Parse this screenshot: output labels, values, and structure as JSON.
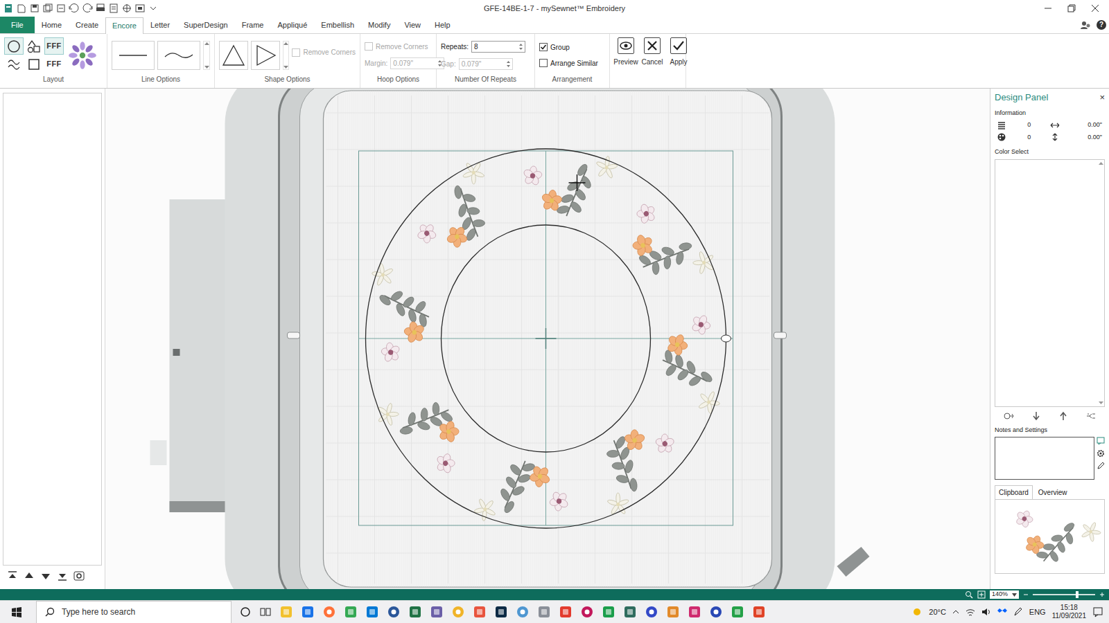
{
  "window": {
    "title": "GFE-14BE-1-7 - mySewnet™ Embroidery"
  },
  "tabs": [
    {
      "label": "File",
      "selected": false
    },
    {
      "label": "Home",
      "selected": false
    },
    {
      "label": "Create",
      "selected": false
    },
    {
      "label": "Encore",
      "selected": true
    },
    {
      "label": "Letter",
      "selected": false
    },
    {
      "label": "SuperDesign",
      "selected": false
    },
    {
      "label": "Frame",
      "selected": false
    },
    {
      "label": "Appliqué",
      "selected": false
    },
    {
      "label": "Embellish",
      "selected": false
    },
    {
      "label": "Modify",
      "selected": false
    },
    {
      "label": "View",
      "selected": false
    },
    {
      "label": "Help",
      "selected": false
    }
  ],
  "help_glyph": "?",
  "ribbon": {
    "layout": {
      "label": "Layout",
      "options": [
        {
          "kind": "circle",
          "selected": true
        },
        {
          "kind": "shapes",
          "selected": false
        },
        {
          "kind": "text",
          "label": "FFF",
          "selected": true
        },
        {
          "kind": "wave",
          "selected": false
        },
        {
          "kind": "square",
          "selected": false
        },
        {
          "kind": "text",
          "label": "FFF",
          "selected": false
        }
      ]
    },
    "line_options": {
      "label": "Line Options"
    },
    "shape_options": {
      "label": "Shape Options",
      "remove_corners": {
        "label": "Remove Corners",
        "checked": false,
        "disabled": true
      }
    },
    "hoop_options": {
      "label": "Hoop Options",
      "remove_corners": {
        "label": "Remove Corners",
        "checked": false,
        "disabled": true
      },
      "margin": {
        "label": "Margin:",
        "value": "0.079\"",
        "disabled": true
      }
    },
    "number_of_repeats": {
      "label": "Number Of Repeats",
      "repeats": {
        "label": "Repeats:",
        "value": "8",
        "disabled": false
      },
      "gap": {
        "label": "Gap:",
        "value": "0.079\"",
        "disabled": true
      }
    },
    "arrangement": {
      "label": "Arrangement",
      "group": {
        "label": "Group",
        "checked": true
      },
      "arrange_similar": {
        "label": "Arrange Similar",
        "checked": false
      }
    },
    "actions": [
      {
        "label": "Preview",
        "kind": "preview"
      },
      {
        "label": "Cancel",
        "kind": "cancel"
      },
      {
        "label": "Apply",
        "kind": "apply"
      }
    ]
  },
  "design_panel": {
    "title": "Design Panel",
    "close": "×",
    "information": "Information",
    "stitches": "0",
    "colors": "0",
    "width": "0.00\"",
    "height": "0.00\"",
    "color_select": "Color Select",
    "notes": "Notes and Settings",
    "tabs": [
      {
        "label": "Clipboard",
        "selected": true
      },
      {
        "label": "Overview",
        "selected": false
      }
    ]
  },
  "status_bar": {
    "zoom": "140%"
  },
  "taskbar": {
    "search_placeholder": "Type here to search",
    "temperature": "20°C",
    "language": "ENG",
    "time": "15:18",
    "date": "11/09/2021"
  }
}
